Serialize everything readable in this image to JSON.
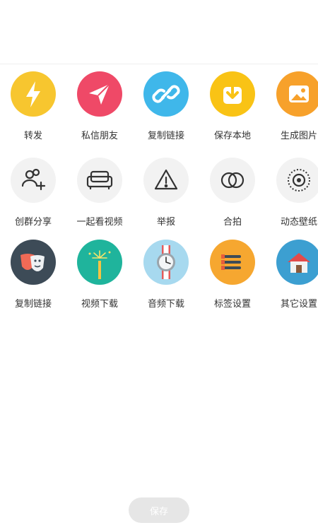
{
  "rows": [
    [
      {
        "label": "转发",
        "icon": "lightning-icon",
        "color": "#f7c62f"
      },
      {
        "label": "私信朋友",
        "icon": "paper-plane-icon",
        "color": "#ef4967"
      },
      {
        "label": "复制链接",
        "icon": "link-icon",
        "color": "#3fb7ea"
      },
      {
        "label": "保存本地",
        "icon": "download-icon",
        "color": "#f9c315"
      },
      {
        "label": "生成图片",
        "icon": "image-icon",
        "color": "#f7a12b"
      }
    ],
    [
      {
        "label": "创群分享",
        "icon": "group-add-icon",
        "color": "#f2f2f2"
      },
      {
        "label": "一起看视频",
        "icon": "sofa-icon",
        "color": "#f2f2f2"
      },
      {
        "label": "举报",
        "icon": "warning-icon",
        "color": "#f2f2f2"
      },
      {
        "label": "合拍",
        "icon": "duet-icon",
        "color": "#f2f2f2"
      },
      {
        "label": "动态壁纸",
        "icon": "wallpaper-icon",
        "color": "#f2f2f2"
      }
    ],
    [
      {
        "label": "复制链接",
        "icon": "theater-masks-icon",
        "color": "#3d4b57"
      },
      {
        "label": "视频下载",
        "icon": "firework-icon",
        "color": "#1fb49c"
      },
      {
        "label": "音频下载",
        "icon": "watch-icon",
        "color": "#a7d9ef"
      },
      {
        "label": "标签设置",
        "icon": "list-settings-icon",
        "color": "#f6a730"
      },
      {
        "label": "其它设置",
        "icon": "house-icon",
        "color": "#3c9fd1"
      }
    ]
  ],
  "save_button": {
    "label": "保存"
  }
}
